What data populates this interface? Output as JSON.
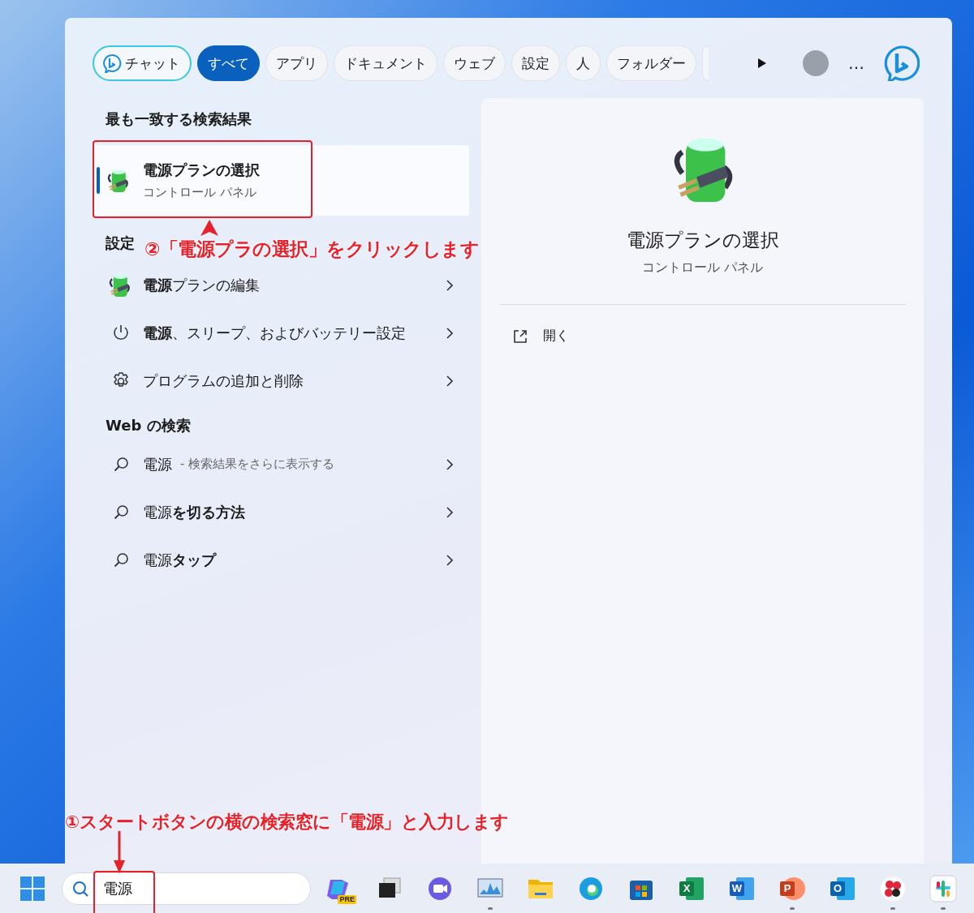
{
  "filter_tabs": [
    {
      "label": "チャット",
      "kind": "chat",
      "selected": false
    },
    {
      "label": "すべて",
      "kind": "plain",
      "selected": true
    },
    {
      "label": "アプリ",
      "kind": "plain",
      "selected": false
    },
    {
      "label": "ドキュメント",
      "kind": "plain",
      "selected": false
    },
    {
      "label": "ウェブ",
      "kind": "plain",
      "selected": false
    },
    {
      "label": "設定",
      "kind": "plain",
      "selected": false
    },
    {
      "label": "人",
      "kind": "plain",
      "selected": false
    },
    {
      "label": "フォルダー",
      "kind": "plain",
      "selected": false
    }
  ],
  "more_options": "…",
  "best_match": {
    "heading": "最も一致する検索結果",
    "title": "電源プランの選択",
    "subtitle": "コントロール パネル",
    "selected": true
  },
  "settings": {
    "heading": "設定",
    "items": [
      {
        "label": "**電源**プランの編集",
        "kind": "plan"
      },
      {
        "label": "**電源**、スリープ、およびバッテリー設定",
        "kind": "power"
      },
      {
        "label": "プログラムの追加と削除",
        "kind": "program"
      }
    ]
  },
  "web_search": {
    "heading": "Web の検索",
    "items": [
      {
        "label": "電源",
        "hint": "- 検索結果をさらに表示する"
      },
      {
        "label": "電源**を切る方法**"
      },
      {
        "label": "電源**タップ**"
      }
    ]
  },
  "preview": {
    "title": "電源プランの選択",
    "subtitle": "コントロール パネル",
    "actions": [
      {
        "label": "開く"
      }
    ]
  },
  "taskbar": {
    "search": {
      "value": "電源"
    },
    "apps": [
      {
        "kind": "copilot",
        "label": "PRE",
        "running": false
      },
      {
        "kind": "taskview",
        "running": false
      },
      {
        "kind": "meet",
        "running": false
      },
      {
        "kind": "monitor",
        "running": true
      },
      {
        "kind": "folder",
        "running": false
      },
      {
        "kind": "browser",
        "running": false
      },
      {
        "kind": "store",
        "running": false
      },
      {
        "kind": "sheet",
        "label": "X",
        "running": false
      },
      {
        "kind": "doc",
        "label": "W",
        "running": false
      },
      {
        "kind": "slides",
        "label": "P",
        "running": true
      },
      {
        "kind": "mail",
        "label": "O",
        "running": false
      },
      {
        "kind": "flower",
        "running": true
      },
      {
        "kind": "grid",
        "running": true
      }
    ]
  },
  "annotations": [
    {
      "kind": "click",
      "text": "②「電源プラの選択」をクリックします"
    },
    {
      "kind": "type",
      "text": "①スタートボタンの横の検索窓に「電源」と入力します"
    }
  ]
}
